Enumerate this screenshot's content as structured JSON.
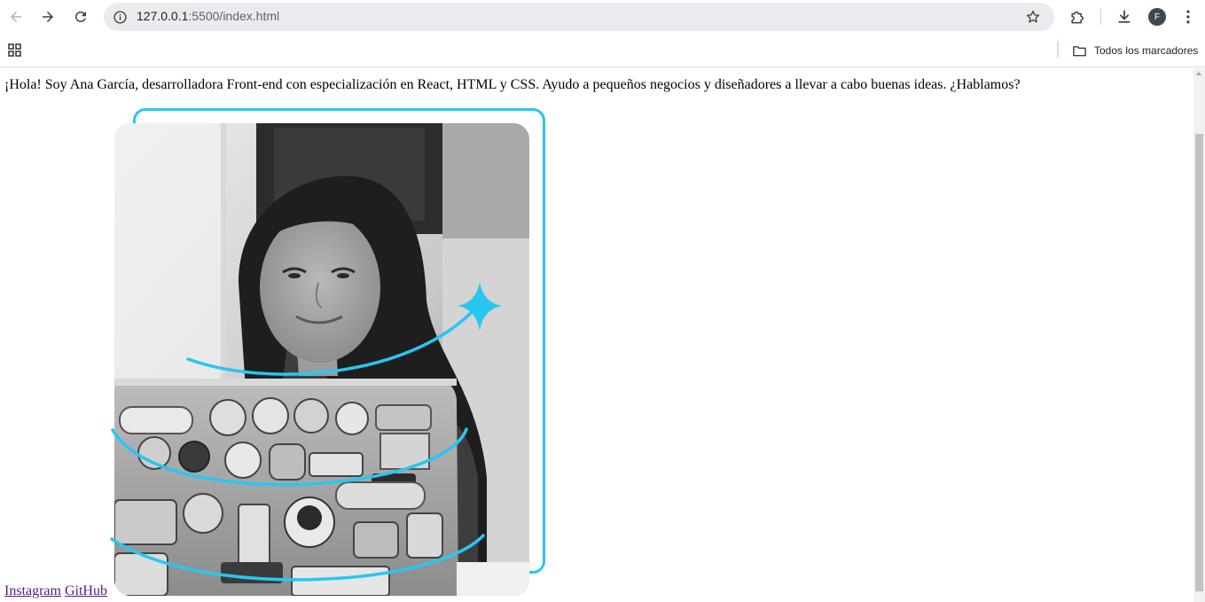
{
  "browser": {
    "url_host": "127.0.0.1",
    "url_path": ":5500/index.html",
    "bookmarks_folder": "Todos los marcadores",
    "profile_initial": "F"
  },
  "page": {
    "intro_text": "¡Hola! Soy Ana García, desarrolladora Front-end con especialización en React, HTML y CSS. Ayudo a pequeños negocios y diseñadores a llevar a cabo buenas ideas. ¿Hablamos?",
    "links": [
      {
        "label": "Instagram"
      },
      {
        "label": "GitHub"
      }
    ],
    "accent_color": "#29c6f1"
  }
}
